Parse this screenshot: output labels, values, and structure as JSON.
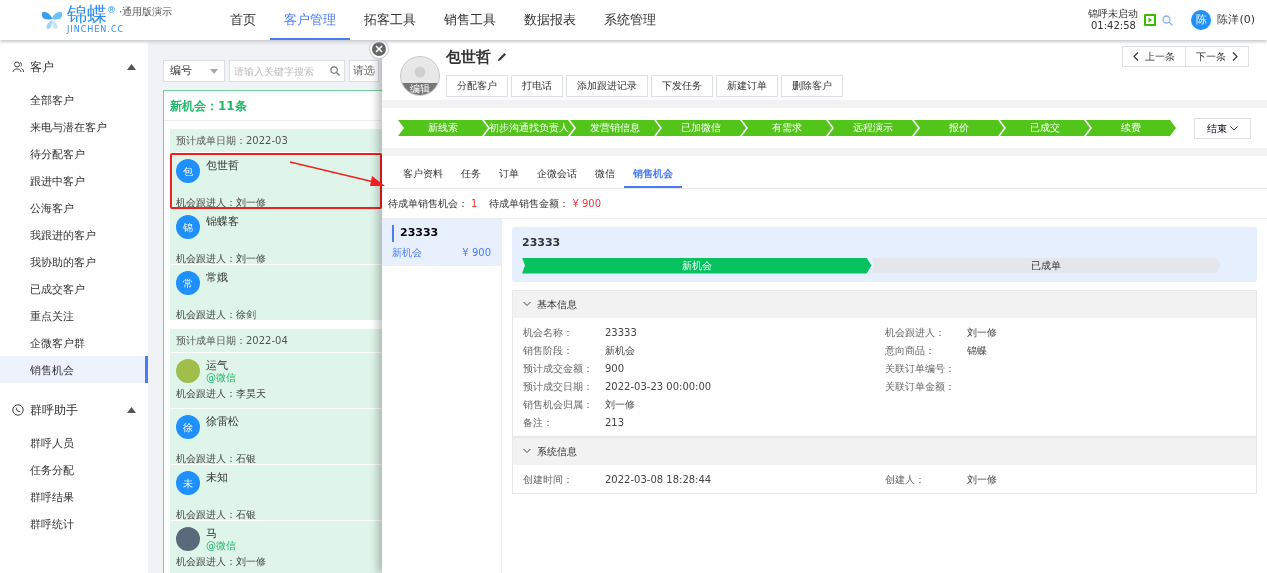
{
  "header": {
    "logo": {
      "brand": "锦蝶",
      "mark": "®",
      "edition": "·通用版演示",
      "domain": "JINCHEN.CC"
    },
    "nav": [
      {
        "label": "首页",
        "selected": false
      },
      {
        "label": "客户管理",
        "selected": true
      },
      {
        "label": "拓客工具",
        "selected": false
      },
      {
        "label": "销售工具",
        "selected": false
      },
      {
        "label": "数据报表",
        "selected": false
      },
      {
        "label": "系统管理",
        "selected": false
      }
    ],
    "call_status": "锦呼未启动",
    "call_timer": "01:42:58",
    "user": {
      "initial": "陈",
      "name": "陈洋(0)"
    }
  },
  "sidebar": [
    {
      "title": "客户",
      "expanded": true,
      "items": [
        {
          "label": "全部客户",
          "selected": false
        },
        {
          "label": "来电与潜在客户",
          "selected": false
        },
        {
          "label": "待分配客户",
          "selected": false
        },
        {
          "label": "跟进中客户",
          "selected": false
        },
        {
          "label": "公海客户",
          "selected": false
        },
        {
          "label": "我跟进的客户",
          "selected": false
        },
        {
          "label": "我协助的客户",
          "selected": false
        },
        {
          "label": "已成交客户",
          "selected": false
        },
        {
          "label": "重点关注",
          "selected": false
        },
        {
          "label": "企微客户群",
          "selected": false
        },
        {
          "label": "销售机会",
          "selected": true
        }
      ]
    },
    {
      "title": "群呼助手",
      "expanded": true,
      "items": [
        {
          "label": "群呼人员",
          "selected": false
        },
        {
          "label": "任务分配",
          "selected": false
        },
        {
          "label": "群呼结果",
          "selected": false
        },
        {
          "label": "群呼统计",
          "selected": false
        }
      ]
    }
  ],
  "list_panel": {
    "filter_select": "编号",
    "search": {
      "placeholder": "请输入关键字搜索"
    },
    "filter_more": "请选",
    "title": "新机会：11条",
    "groups": [
      {
        "date": "预计成单日期：2022-03",
        "items": [
          {
            "kind": "letter",
            "initial": "包",
            "name": "包世哲",
            "owner": "机会跟进人：刘一修",
            "highlighted": true
          },
          {
            "kind": "letter",
            "initial": "锦",
            "name": "锦蝶客",
            "owner": "机会跟进人：刘一修",
            "highlighted": false
          },
          {
            "kind": "letter",
            "initial": "常",
            "name": "常娥",
            "owner": "机会跟进人：徐剑",
            "highlighted": false
          }
        ]
      },
      {
        "date": "预计成单日期：2022-04",
        "items": [
          {
            "kind": "photo",
            "name": "运气",
            "source": "@微信",
            "owner": "机会跟进人：李昊天",
            "highlighted": false
          },
          {
            "kind": "letter",
            "initial": "徐",
            "name": "徐雷松",
            "owner": "机会跟进人：石银",
            "highlighted": false
          },
          {
            "kind": "letter",
            "initial": "未",
            "name": "未知",
            "owner": "机会跟进人：石银",
            "highlighted": false
          },
          {
            "kind": "photo",
            "name": "马",
            "source": "@微信",
            "owner": "机会跟进人：刘一修",
            "highlighted": false
          }
        ]
      }
    ]
  },
  "drawer": {
    "avatar_label": "编辑",
    "customer_name": "包世哲",
    "prev": "上一条",
    "next": "下一条",
    "actions": [
      "分配客户",
      "打电话",
      "添加跟进记录",
      "下发任务",
      "新建订单",
      "删除客户"
    ],
    "stages": [
      {
        "label": "新线索",
        "done": true
      },
      {
        "label": "初步沟通找负责人",
        "done": true
      },
      {
        "label": "发营销信息",
        "done": true
      },
      {
        "label": "已加微信",
        "done": true
      },
      {
        "label": "有需求",
        "done": true
      },
      {
        "label": "远程演示",
        "done": true
      },
      {
        "label": "报价",
        "done": true
      },
      {
        "label": "已成交",
        "done": true
      },
      {
        "label": "续费",
        "done": true
      }
    ],
    "end_button": "结束",
    "tabs": [
      {
        "label": "客户资料",
        "selected": false
      },
      {
        "label": "任务",
        "selected": false
      },
      {
        "label": "订单",
        "selected": false
      },
      {
        "label": "企微会话",
        "selected": false
      },
      {
        "label": "微信",
        "selected": false
      },
      {
        "label": "销售机会",
        "selected": true
      }
    ],
    "summary": [
      {
        "label": "待成单销售机会：",
        "value": "1"
      },
      {
        "label": "待成单销售金额：",
        "value": "¥ 900"
      }
    ],
    "opportunities": [
      {
        "title": "23333",
        "stage": "新机会",
        "amount": "¥ 900",
        "selected": true
      }
    ],
    "detail": {
      "title": "23333",
      "progress": [
        {
          "label": "新机会",
          "reached": true
        },
        {
          "label": "已成单",
          "reached": false
        }
      ],
      "sections": [
        {
          "title": "基本信息",
          "expanded": true,
          "left": [
            {
              "label": "机会名称：",
              "value": "23333"
            },
            {
              "label": "销售阶段：",
              "value": "新机会"
            },
            {
              "label": "预计成交金额：",
              "value": "900"
            },
            {
              "label": "预计成交日期：",
              "value": "2022-03-23 00:00:00"
            },
            {
              "label": "销售机会归属：",
              "value": "刘一修"
            },
            {
              "label": "备注：",
              "value": "213"
            }
          ],
          "right": [
            {
              "label": "机会跟进人：",
              "value": "刘一修"
            },
            {
              "label": "意向商品：",
              "value": "锦蝶"
            },
            {
              "label": "关联订单编号："
            },
            {
              "label": "关联订单金额："
            }
          ]
        },
        {
          "title": "系统信息",
          "expanded": true,
          "left": [
            {
              "label": "创建时间：",
              "value": "2022-03-08 18:28:44"
            }
          ],
          "right": [
            {
              "label": "创建人：",
              "value": "刘一修"
            }
          ]
        }
      ]
    }
  }
}
